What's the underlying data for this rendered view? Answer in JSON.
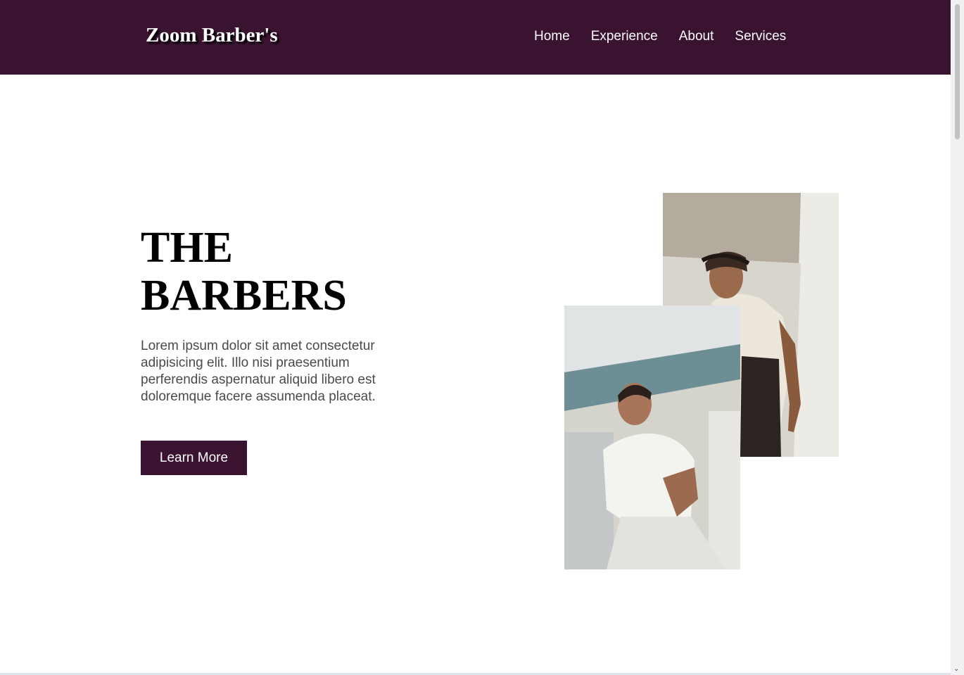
{
  "header": {
    "logo": "Zoom Barber's",
    "nav": [
      {
        "label": "Home"
      },
      {
        "label": "Experience"
      },
      {
        "label": "About"
      },
      {
        "label": "Services"
      }
    ]
  },
  "hero": {
    "title_line1": "THE",
    "title_line2": "BARBERS",
    "text": "Lorem ipsum dolor sit amet consectetur adipisicing elit. Illo nisi praesentium perferendis aspernatur aliquid libero est doloremque facere assumenda placeat.",
    "button_label": "Learn More"
  },
  "icons": {
    "scroll_down": "scroll-down-arrow-icon"
  },
  "colors": {
    "brand": "#3a1330",
    "text_body": "#4a4a4a",
    "background": "#ffffff"
  }
}
